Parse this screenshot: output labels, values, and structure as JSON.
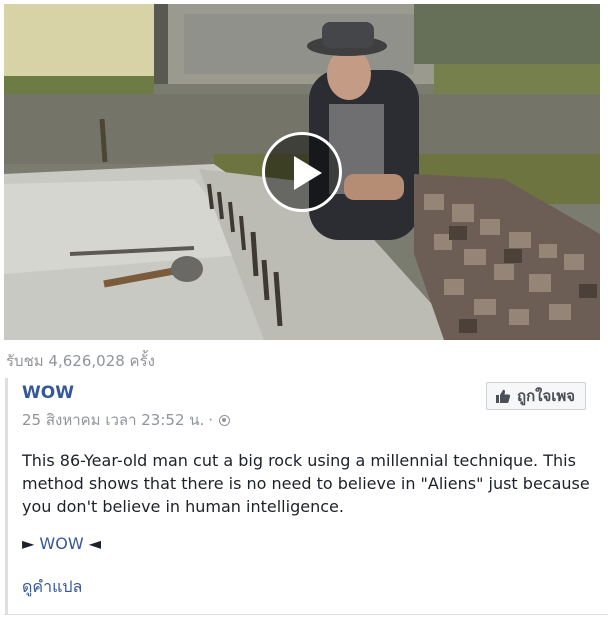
{
  "video": {
    "views_text": "รับชม 4,626,028 ครั้ง",
    "play_icon": "play-icon"
  },
  "post": {
    "page_name": "WOW",
    "timestamp": "25 สิงหาคม เวลา 23:52 น.",
    "separator": "·",
    "privacy_icon": "globe-icon",
    "like_page_label": "ถูกใจเพจ",
    "like_icon": "thumbs-up-icon",
    "text": "This 86-Year-old man cut a big rock using a millennial technique. This method shows that there is no need to believe in \"Aliens\" just because you don't believe in human intelligence.",
    "hashtag_prefix": "►",
    "hashtag_link": "WOW",
    "hashtag_suffix": "◄",
    "see_translation": "ดูคำแปล"
  },
  "colors": {
    "link": "#365899",
    "muted": "#90949c",
    "text": "#1d2129"
  }
}
